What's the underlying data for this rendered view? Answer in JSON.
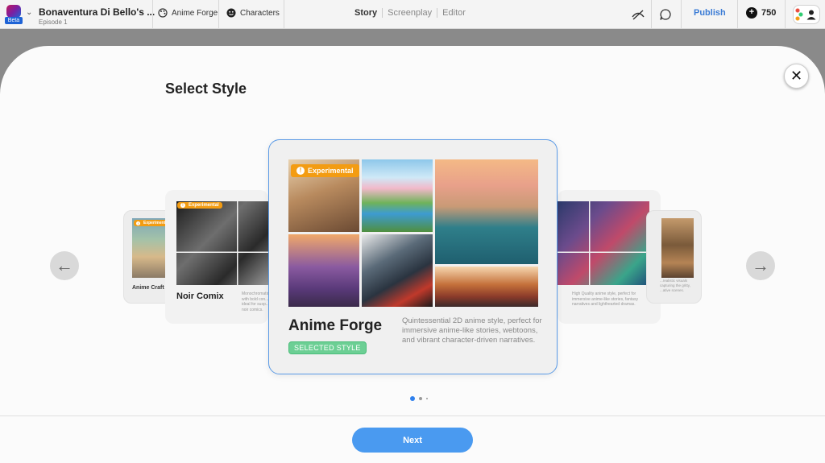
{
  "topbar": {
    "beta_label": "Beta",
    "project_title": "Bonaventura Di Bello's ...",
    "episode": "Episode 1",
    "style_item": "Anime Forge",
    "characters_item": "Characters",
    "modes": [
      "Story",
      "Screenplay",
      "Editor"
    ],
    "publish_label": "Publish",
    "credits": "750"
  },
  "modal": {
    "title": "Select Style",
    "close_icon": "close-icon",
    "next_label": "Next",
    "pager": {
      "count": 3,
      "active": 0
    }
  },
  "styles": {
    "far_left": {
      "name": "Anime Craft",
      "badge": "Experimental"
    },
    "left": {
      "name": "Noir Comix",
      "badge": "Experimental",
      "desc": "Monochromatic ... with bold con... ideal for susp... noir comics."
    },
    "center": {
      "name": "Anime Forge",
      "badge": "Experimental",
      "status": "SELECTED STYLE",
      "desc": "Quintessential 2D anime style, perfect for immersive anime-like stories, webtoons, and vibrant character-driven narratives."
    },
    "right": {
      "desc": "High Quality anime style, perfect for immersive anime-like stories, fantasy narratives and lighthearted dramas."
    },
    "far_right": {
      "desc": "...realistic visuals capturing the gritty, ...ative scenes."
    }
  },
  "colors": {
    "accent": "#4a9af0",
    "selected_border": "#5b9be6",
    "experimental": "#f39c12",
    "selected_badge": "#6ccf94",
    "publish": "#3a7bd5"
  }
}
